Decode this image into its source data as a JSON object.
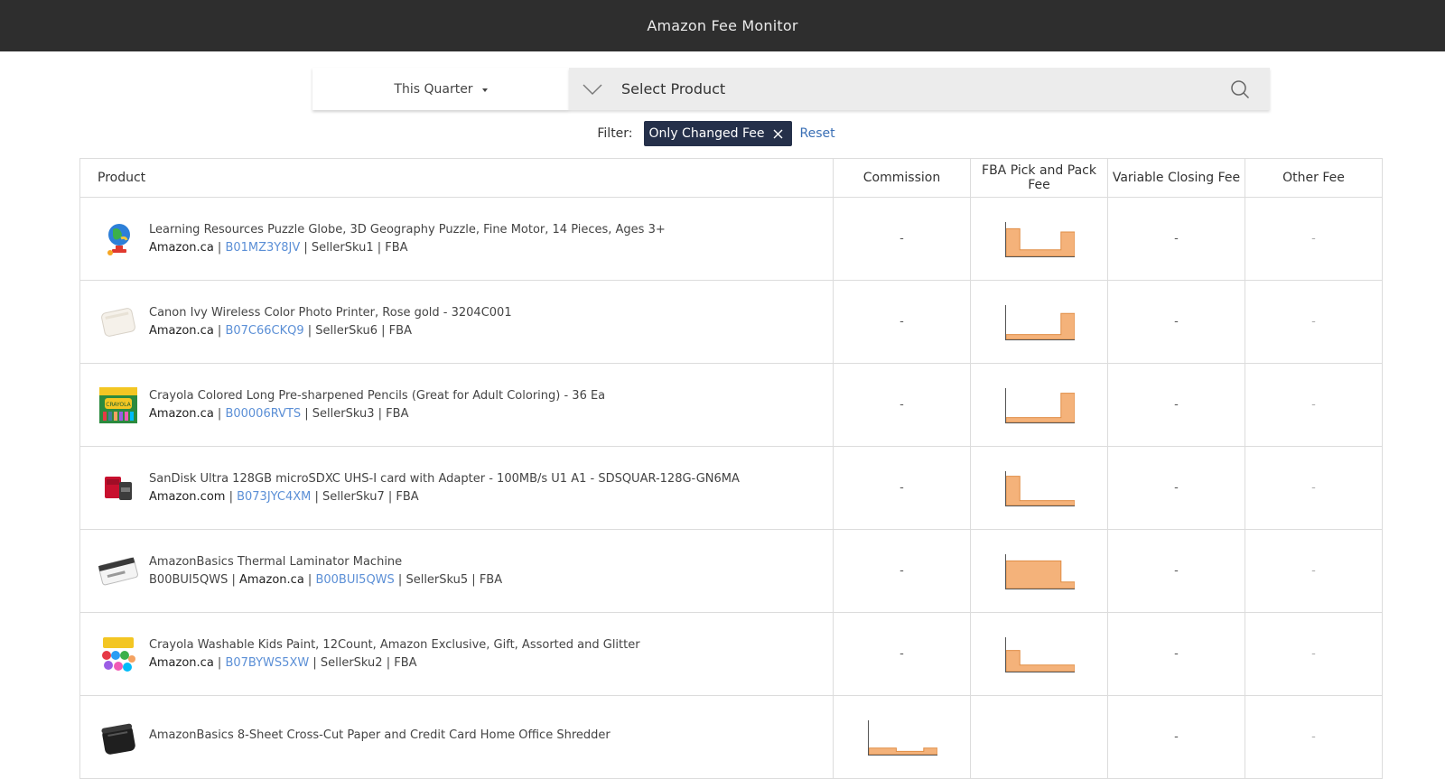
{
  "app": {
    "title": "Amazon Fee Monitor"
  },
  "controls": {
    "period": "This Quarter",
    "product_placeholder": "Select Product"
  },
  "filter": {
    "label": "Filter:",
    "chip": "Only Changed Fee",
    "reset": "Reset"
  },
  "table": {
    "columns": [
      "Product",
      "Commission",
      "FBA Pick and Pack Fee",
      "Variable Closing Fee",
      "Other Fee"
    ],
    "rows": [
      {
        "title": "Learning Resources Puzzle Globe, 3D Geography Puzzle, Fine Motor, 14 Pieces, Ages 3+",
        "prefix": "",
        "marketplace": "Amazon.ca",
        "asin": "B01MZ3Y8JV",
        "sku": "SellerSku1",
        "channel": "FBA",
        "commission": "-",
        "fba_trend": [
          0.85,
          0.2,
          0.2,
          0.2,
          0.75
        ],
        "variable_closing": "-",
        "other": "-",
        "thumb": "globe"
      },
      {
        "title": "Canon Ivy Wireless Color Photo Printer, Rose gold - 3204C001",
        "prefix": "",
        "marketplace": "Amazon.ca",
        "asin": "B07C66CKQ9",
        "sku": "SellerSku6",
        "channel": "FBA",
        "commission": "-",
        "fba_trend": [
          0.15,
          0.15,
          0.15,
          0.15,
          0.8
        ],
        "variable_closing": "-",
        "other": "-",
        "thumb": "printer"
      },
      {
        "title": "Crayola Colored Long Pre-sharpened Pencils (Great for Adult Coloring) - 36 Ea",
        "prefix": "",
        "marketplace": "Amazon.ca",
        "asin": "B00006RVTS",
        "sku": "SellerSku3",
        "channel": "FBA",
        "commission": "-",
        "fba_trend": [
          0.15,
          0.15,
          0.15,
          0.15,
          0.9
        ],
        "variable_closing": "-",
        "other": "-",
        "thumb": "pencils"
      },
      {
        "title": "SanDisk Ultra 128GB microSDXC UHS-I card with Adapter - 100MB/s U1 A1 - SDSQUAR-128G-GN6MA",
        "prefix": "",
        "marketplace": "Amazon.com",
        "asin": "B073JYC4XM",
        "sku": "SellerSku7",
        "channel": "FBA",
        "commission": "-",
        "fba_trend": [
          0.9,
          0.15,
          0.15,
          0.15,
          0.15
        ],
        "variable_closing": "-",
        "other": "-",
        "thumb": "sdcard"
      },
      {
        "title": "AmazonBasics Thermal Laminator Machine",
        "prefix": "B00BUI5QWS",
        "marketplace": "Amazon.ca",
        "asin": "B00BUI5QWS",
        "sku": "SellerSku5",
        "channel": "FBA",
        "commission": "-",
        "fba_trend": [
          0.85,
          0.85,
          0.85,
          0.85,
          0.2
        ],
        "variable_closing": "-",
        "other": "-",
        "thumb": "laminator"
      },
      {
        "title": "Crayola Washable Kids Paint, 12Count, Amazon Exclusive, Gift, Assorted and Glitter",
        "prefix": "",
        "marketplace": "Amazon.ca",
        "asin": "B07BYWS5XW",
        "sku": "SellerSku2",
        "channel": "FBA",
        "commission": "-",
        "fba_trend": [
          0.65,
          0.2,
          0.2,
          0.2,
          0.2
        ],
        "variable_closing": "-",
        "other": "-",
        "thumb": "paint"
      },
      {
        "title": "AmazonBasics 8-Sheet Cross-Cut Paper and Credit Card Home Office Shredder",
        "prefix": "",
        "marketplace": "",
        "asin": "",
        "sku": "",
        "channel": "",
        "commission_trend": [
          0.2,
          0.2,
          0.1,
          0.1,
          0.2
        ],
        "commission": "",
        "fba_trend": [],
        "variable_closing": "-",
        "other": "-",
        "thumb": "shredder"
      }
    ]
  },
  "colors": {
    "topbar": "#2e2e2e",
    "chip": "#25304a",
    "link": "#5b8fd6",
    "spark_fill": "#f4b27a",
    "spark_stroke": "#e08d45"
  }
}
